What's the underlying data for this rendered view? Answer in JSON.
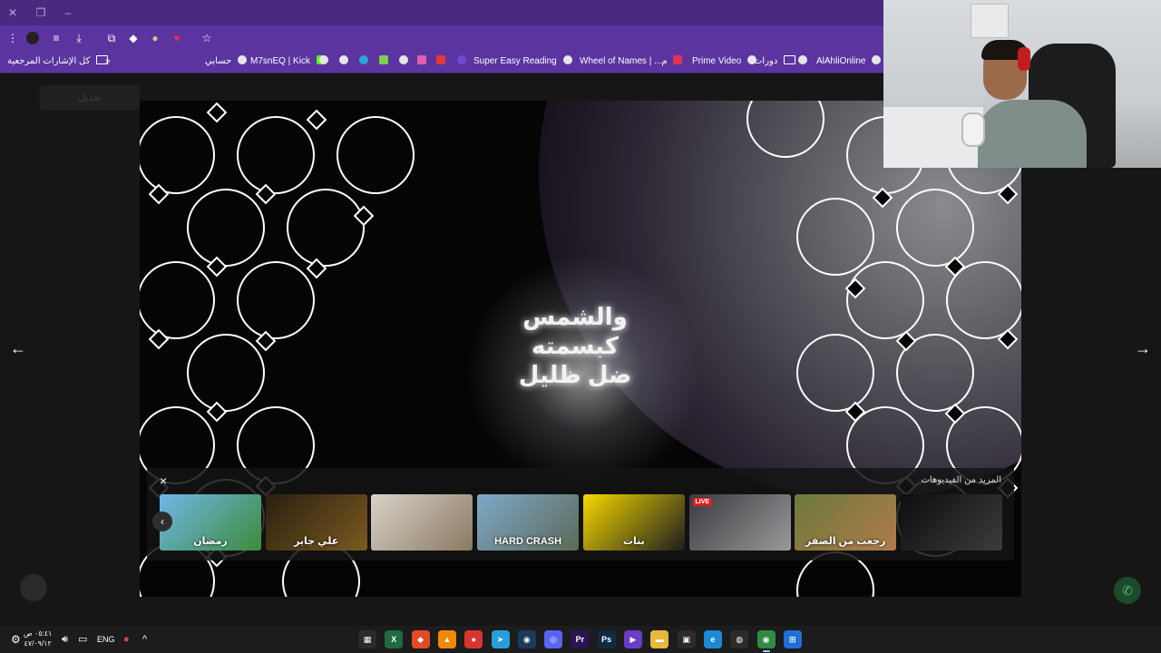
{
  "browser": {
    "bookmarks": [
      {
        "label": "كل الإشارات المرجعية",
        "kind": "folder"
      },
      {
        "label": "حسابي",
        "kind": "site"
      },
      {
        "label": "M7snEQ | Kick",
        "kind": "site"
      },
      {
        "label": "Super Easy Reading",
        "kind": "site"
      },
      {
        "label": "Wheel of Names | ...م",
        "kind": "site"
      },
      {
        "label": "Prime Video",
        "kind": "site"
      },
      {
        "label": "دورات",
        "kind": "folder"
      },
      {
        "label": "AlAhliOnline",
        "kind": "site"
      }
    ],
    "overflow_label": "»"
  },
  "video": {
    "caption_lines": [
      "والشمس",
      "كبسمته",
      "ضل ظليل"
    ]
  },
  "more_videos": {
    "title": "المزيد من الفيديوهات",
    "close_label": "×",
    "thumbnails": [
      {
        "label": "رمضان",
        "badge": "",
        "colors": [
          "#6fb6e8",
          "#3d8c3a"
        ]
      },
      {
        "label": "علي جابر",
        "badge": "",
        "colors": [
          "#2a1f10",
          "#7a5a20"
        ]
      },
      {
        "label": "",
        "badge": "",
        "colors": [
          "#d8d2c8",
          "#8a7a62"
        ]
      },
      {
        "label": "HARD CRASH",
        "badge": "",
        "colors": [
          "#7ea8c9",
          "#5c6a58"
        ]
      },
      {
        "label": "بنات",
        "badge": "",
        "colors": [
          "#f5d800",
          "#1d1d1d"
        ]
      },
      {
        "label": "",
        "badge": "LIVE",
        "colors": [
          "#3a3a40",
          "#9a9a9a"
        ]
      },
      {
        "label": "رجعت من الصفر",
        "badge": "",
        "colors": [
          "#6c7a3e",
          "#b07a48"
        ]
      },
      {
        "label": "",
        "badge": "",
        "colors": [
          "#0d0d0d",
          "#3c3c3c"
        ]
      }
    ]
  },
  "page": {
    "ghost_button_label": "تعديل",
    "prev_arrow": "←",
    "next_arrow": "→"
  },
  "taskbar": {
    "language": "ENG",
    "time": "٠٥:٤١ ص",
    "date": "٤٧/٠٩/١٢",
    "apps": [
      {
        "name": "calendar",
        "glyph": "▦",
        "color": "#2b2b2b"
      },
      {
        "name": "excel",
        "glyph": "X",
        "color": "#1d6b3f"
      },
      {
        "name": "brave",
        "glyph": "◆",
        "color": "#e24b26"
      },
      {
        "name": "vlc",
        "glyph": "▲",
        "color": "#f08a00"
      },
      {
        "name": "app-red",
        "glyph": "●",
        "color": "#d9352f"
      },
      {
        "name": "telegram",
        "glyph": "➤",
        "color": "#2a9ed8"
      },
      {
        "name": "steam",
        "glyph": "◉",
        "color": "#1b3a5c"
      },
      {
        "name": "discord",
        "glyph": "◎",
        "color": "#5865f2"
      },
      {
        "name": "premiere",
        "glyph": "Pr",
        "color": "#2a1454"
      },
      {
        "name": "photoshop",
        "glyph": "Ps",
        "color": "#0f2a44"
      },
      {
        "name": "player",
        "glyph": "▶",
        "color": "#6a3cc8"
      },
      {
        "name": "files",
        "glyph": "▬",
        "color": "#e8b83a"
      },
      {
        "name": "store",
        "glyph": "▣",
        "color": "#2b2b2b"
      },
      {
        "name": "edge",
        "glyph": "e",
        "color": "#1a8ad4"
      },
      {
        "name": "obs",
        "glyph": "◍",
        "color": "#2b2b2b"
      },
      {
        "name": "chrome",
        "glyph": "◉",
        "color": "#2f8a44"
      },
      {
        "name": "windows",
        "glyph": "⊞",
        "color": "#1f6fd6"
      }
    ]
  }
}
